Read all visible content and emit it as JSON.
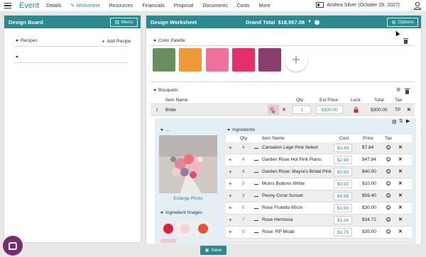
{
  "topbar": {
    "app_title": "Event",
    "nav": [
      "Details",
      "Worksheet",
      "Resources",
      "Financials",
      "Proposal",
      "Documents",
      "Costs",
      "More"
    ],
    "user": "Andrea Silver (October 29, 2027)"
  },
  "left_panel": {
    "title": "Design Board",
    "menu_label": "Menu",
    "recipes_label": "Recipes",
    "add_recipe": "Add Recipe"
  },
  "right_panel": {
    "title": "Design Worksheet",
    "grand_total_label": "Grand Total",
    "grand_total": "$18,567.08",
    "options_label": "Options",
    "color_palette_label": "Color Palette",
    "swatches": [
      "#6a8f5e",
      "#ee9a36",
      "#f0709d",
      "#e62f68",
      "#8a3e6c"
    ],
    "bouquets_label": "Bouquets",
    "columns": {
      "item_name": "Item Name",
      "qty": "Qty",
      "est_price": "Est Price",
      "lock": "Lock",
      "total": "Total",
      "tax": "Tax"
    },
    "bride": {
      "name": "Bride",
      "qty": "1",
      "est_price": "$300.00",
      "total": "$300.00",
      "tax": "TP"
    },
    "photo_section": "...",
    "enlarge_photo": "Enlarge Photo",
    "ingredient_images": "Ingredient Images",
    "ingredients_label": "Ingredients",
    "ing_columns": {
      "qty": "Qty",
      "item_name": "Item Name",
      "cost": "Cost",
      "price": "Price",
      "tax": "Tax"
    },
    "ingredients": [
      {
        "qty": "4",
        "name": "Carnation Lege Pink Select",
        "cost": "$0.49",
        "price": "$7.84"
      },
      {
        "qty": "4",
        "name": "Garden Rose Hot Pink Piano",
        "cost": "$2.99",
        "price": "$47.84"
      },
      {
        "qty": "4",
        "name": "Garden Rose: Mayra's Bridal Pink",
        "cost": "$2.50",
        "price": "$40.00"
      },
      {
        "qty": "5",
        "name": "Mums Buttons White",
        "cost": "$0.50",
        "price": "$10.00"
      },
      {
        "qty": "3",
        "name": "Peony Coral Sunset",
        "cost": "$4.95",
        "price": "$59.40"
      },
      {
        "qty": "5",
        "name": "Rose Frutetto 60cm",
        "cost": "$1.50",
        "price": "$30.00"
      },
      {
        "qty": "7",
        "name": "Rose Hermosa",
        "cost": "$1.24",
        "price": "$34.72"
      },
      {
        "qty": "5",
        "name": "Rose: RP Moab",
        "cost": "$1.75",
        "price": "$35.00"
      }
    ]
  },
  "footer": {
    "save_label": "Save"
  },
  "colors": {
    "accent": "#2a8a8f",
    "lock_red": "#c62828",
    "chat": "#7a2d6e"
  }
}
